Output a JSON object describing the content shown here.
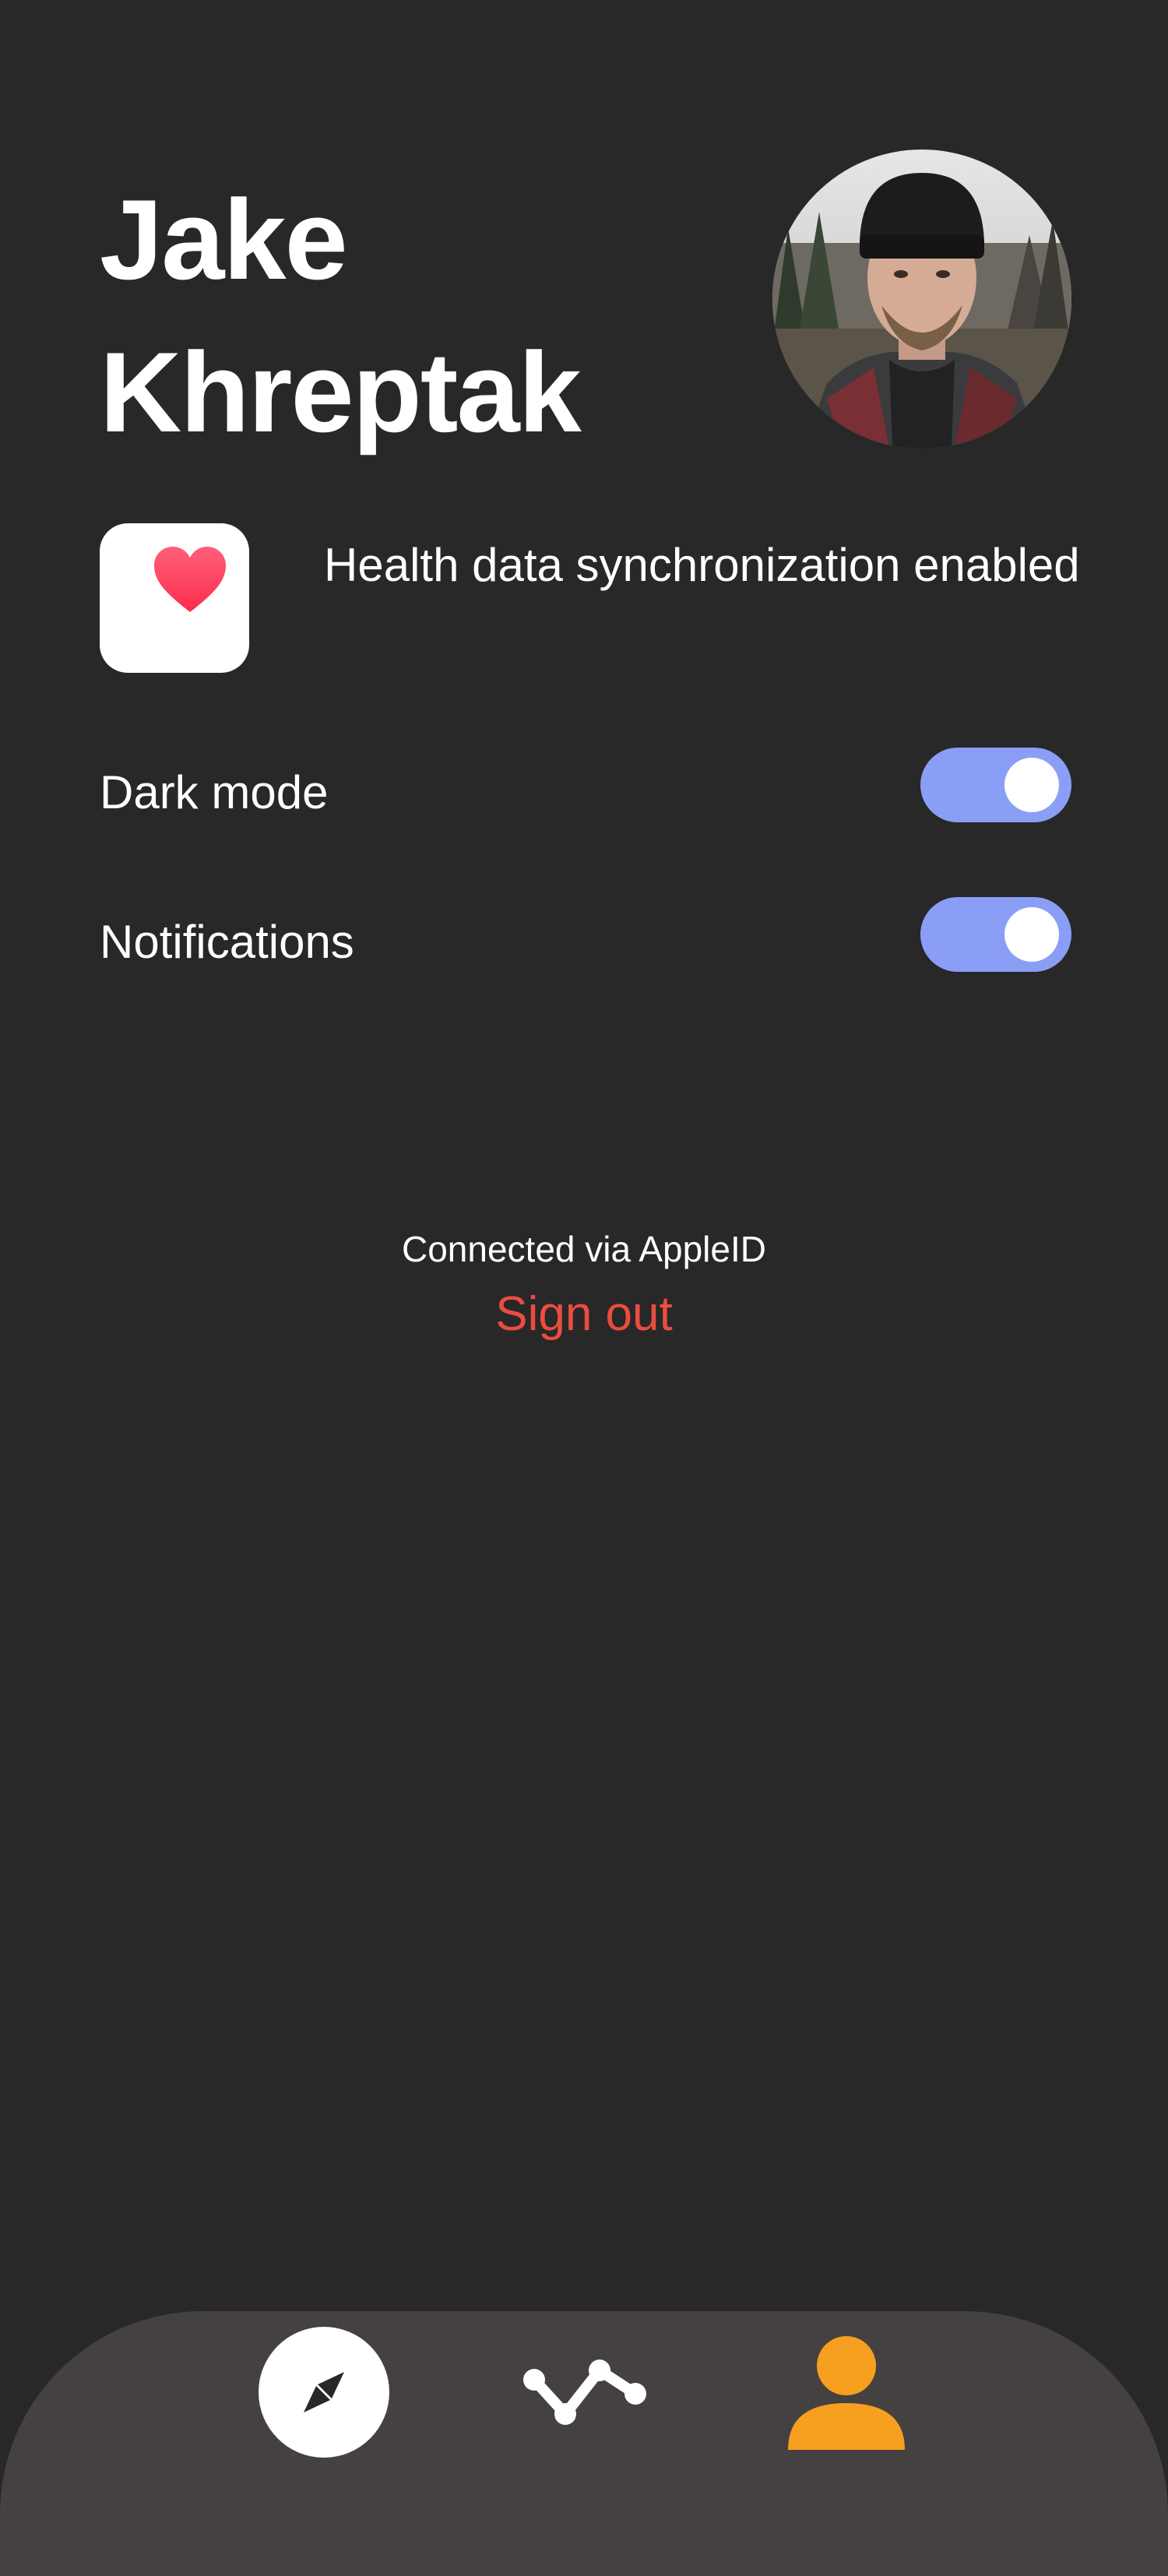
{
  "profile": {
    "first_name": "Jake",
    "last_name": "Khreptak",
    "avatar_icon": "user-photo"
  },
  "health": {
    "icon": "heart-icon",
    "text": "Health data synchronization enabled"
  },
  "settings": {
    "dark_mode": {
      "label": "Dark mode",
      "enabled": true
    },
    "notifications": {
      "label": "Notifications",
      "enabled": true
    }
  },
  "account": {
    "connected_text": "Connected via AppleID",
    "sign_out_label": "Sign out"
  },
  "tab_bar": {
    "tabs": [
      {
        "name": "explore",
        "icon": "compass-icon",
        "active": false
      },
      {
        "name": "stats",
        "icon": "chart-line-icon",
        "active": false
      },
      {
        "name": "profile",
        "icon": "person-icon",
        "active": true
      }
    ]
  },
  "colors": {
    "background": "#282828",
    "toggle_on": "#8a9ef5",
    "sign_out": "#ec4d3e",
    "tab_bar": "#454141",
    "active_tab": "#f7a01f",
    "heart": "#fb3b5a"
  }
}
